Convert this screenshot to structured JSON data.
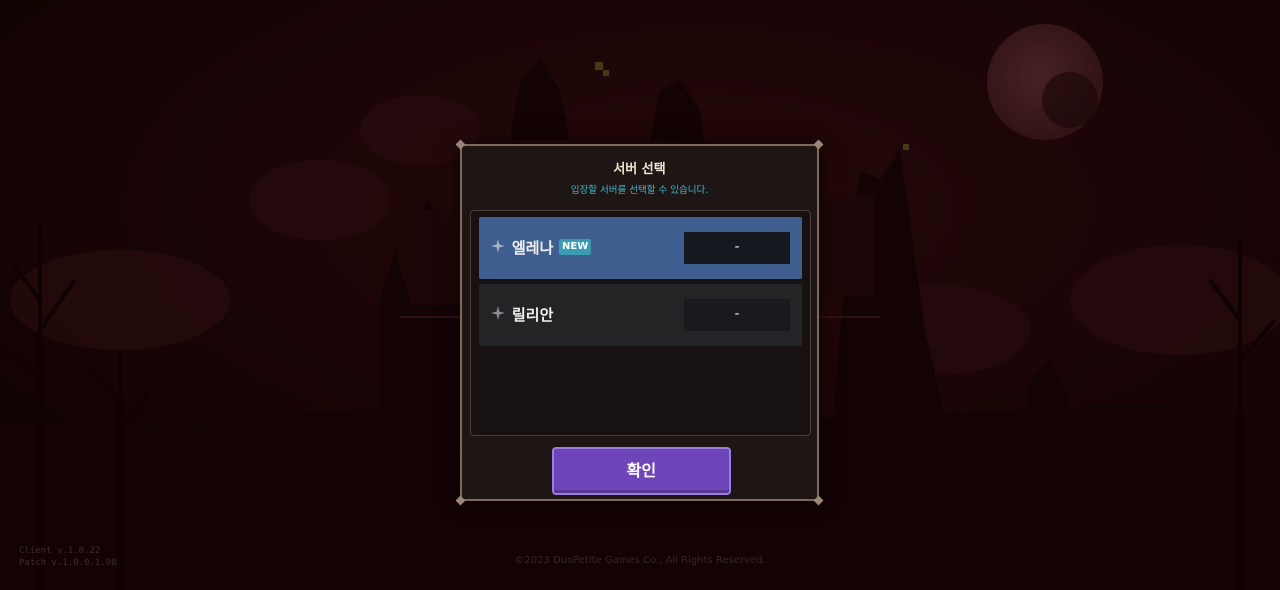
{
  "background": {
    "footer_version": [
      "Client v.1.0.22",
      "Patch v.1.0.0.1.98"
    ],
    "footer_copyright": "©2023 DuoPetite Games Co., All Rights Reserved."
  },
  "dialog": {
    "title": "서버 선택",
    "subtitle": "입장할 서버를 선택할 수 있습니다.",
    "servers": [
      {
        "name": "엘레나",
        "badge": "NEW",
        "status": "-",
        "selected": true
      },
      {
        "name": "릴리안",
        "badge": "",
        "status": "-",
        "selected": false
      }
    ],
    "confirm_label": "확인"
  },
  "colors": {
    "accent_purple": "#6d45b9",
    "selected_row": "#3e5e90",
    "subtitle_cyan": "#3fb9d4",
    "badge_teal": "#3a9bb3"
  }
}
